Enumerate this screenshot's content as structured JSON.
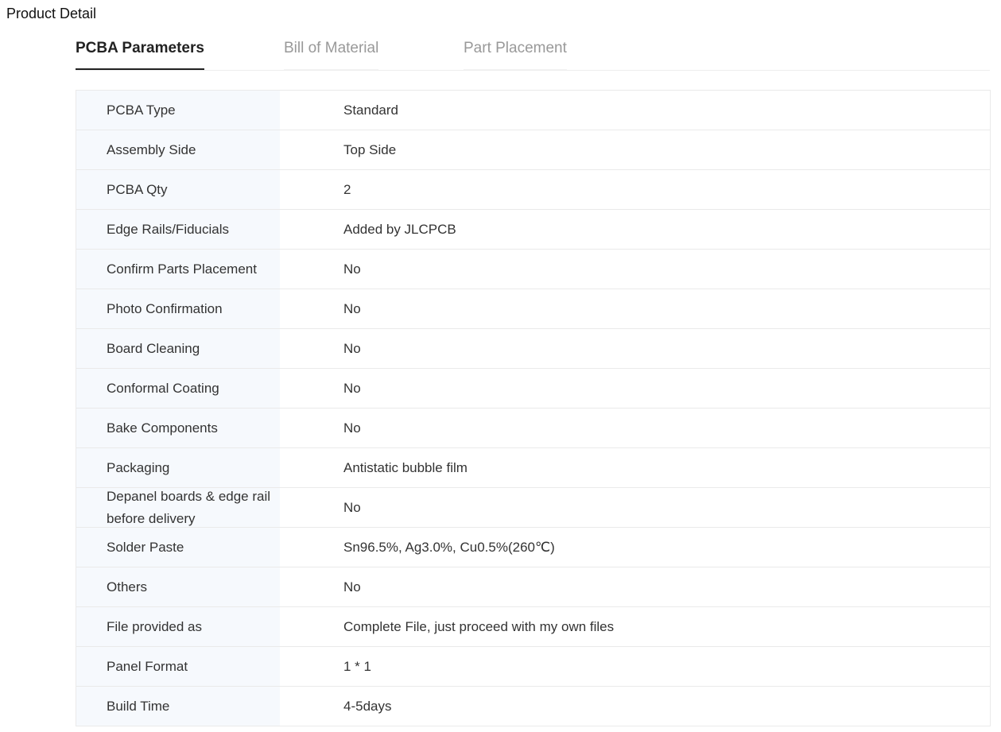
{
  "page": {
    "title": "Product Detail"
  },
  "tabs": [
    {
      "label": "PCBA Parameters",
      "active": true
    },
    {
      "label": "Bill of Material",
      "active": false
    },
    {
      "label": "Part Placement",
      "active": false
    }
  ],
  "params": [
    {
      "label": "PCBA Type",
      "value": "Standard"
    },
    {
      "label": "Assembly Side",
      "value": "Top Side"
    },
    {
      "label": "PCBA Qty",
      "value": "2"
    },
    {
      "label": "Edge Rails/Fiducials",
      "value": "Added by JLCPCB"
    },
    {
      "label": "Confirm Parts Placement",
      "value": "No"
    },
    {
      "label": "Photo Confirmation",
      "value": "No"
    },
    {
      "label": "Board Cleaning",
      "value": "No"
    },
    {
      "label": "Conformal Coating",
      "value": "No"
    },
    {
      "label": "Bake Components",
      "value": "No"
    },
    {
      "label": "Packaging",
      "value": "Antistatic bubble film"
    },
    {
      "label": "Depanel boards & edge rail before delivery",
      "value": "No"
    },
    {
      "label": "Solder Paste",
      "value": "Sn96.5%, Ag3.0%, Cu0.5%(260℃)"
    },
    {
      "label": "Others",
      "value": "No"
    },
    {
      "label": "File provided as",
      "value": "Complete File, just proceed with my own files"
    },
    {
      "label": "Panel Format",
      "value": "1 * 1"
    },
    {
      "label": "Build Time",
      "value": "4-5days"
    }
  ]
}
